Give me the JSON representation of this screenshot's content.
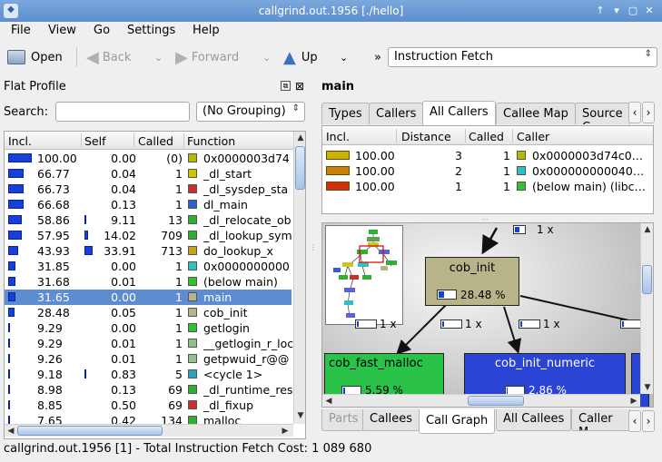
{
  "window": {
    "title": "callgrind.out.1956 [./hello]"
  },
  "menu": [
    "File",
    "View",
    "Go",
    "Settings",
    "Help"
  ],
  "toolbar": {
    "open": "Open",
    "back": "Back",
    "forward": "Forward",
    "up": "Up",
    "event_type": "Instruction Fetch",
    "more": "»"
  },
  "flat_profile": {
    "title": "Flat Profile",
    "search_label": "Search:",
    "search_value": "",
    "grouping": "(No Grouping)",
    "columns": [
      "Incl.",
      "Self",
      "Called",
      "Function"
    ],
    "rows": [
      {
        "incl": "100.00",
        "self": "0.00",
        "called": "(0)",
        "func": "0x0000003d74",
        "color": "#b8b800",
        "incl_frac": 1.0,
        "self_frac": 0
      },
      {
        "incl": "66.77",
        "self": "0.04",
        "called": "1",
        "func": "_dl_start",
        "color": "#c9c900",
        "incl_frac": 0.6677,
        "self_frac": 0
      },
      {
        "incl": "66.73",
        "self": "0.04",
        "called": "1",
        "func": "_dl_sysdep_sta",
        "color": "#c83030",
        "incl_frac": 0.6673,
        "self_frac": 0
      },
      {
        "incl": "66.68",
        "self": "0.13",
        "called": "1",
        "func": "dl_main",
        "color": "#3060c8",
        "incl_frac": 0.6668,
        "self_frac": 0
      },
      {
        "incl": "58.86",
        "self": "9.11",
        "called": "13",
        "func": "_dl_relocate_ob",
        "color": "#30b030",
        "incl_frac": 0.5886,
        "self_frac": 0.0911
      },
      {
        "incl": "57.95",
        "self": "14.02",
        "called": "709",
        "func": "_dl_lookup_sym",
        "color": "#30b030",
        "incl_frac": 0.5795,
        "self_frac": 0.1402
      },
      {
        "incl": "43.93",
        "self": "33.91",
        "called": "713",
        "func": "do_lookup_x",
        "color": "#c8a020",
        "incl_frac": 0.4393,
        "self_frac": 0.3391
      },
      {
        "incl": "31.85",
        "self": "0.00",
        "called": "1",
        "func": "0x0000000000",
        "color": "#30c0c0",
        "incl_frac": 0.3185,
        "self_frac": 0
      },
      {
        "incl": "31.68",
        "self": "0.01",
        "called": "1",
        "func": "(below main)",
        "color": "#30c030",
        "incl_frac": 0.3168,
        "self_frac": 0
      },
      {
        "incl": "31.65",
        "self": "0.00",
        "called": "1",
        "func": "main",
        "color": "#b8b48a",
        "incl_frac": 0.3165,
        "self_frac": 0,
        "selected": true
      },
      {
        "incl": "28.48",
        "self": "0.05",
        "called": "1",
        "func": "cob_init",
        "color": "#b8b48a",
        "incl_frac": 0.2848,
        "self_frac": 0
      },
      {
        "incl": "9.29",
        "self": "0.00",
        "called": "1",
        "func": "getlogin",
        "color": "#30c030",
        "incl_frac": 0.0929,
        "self_frac": 0
      },
      {
        "incl": "9.29",
        "self": "0.01",
        "called": "1",
        "func": "__getlogin_r_loc",
        "color": "#90c090",
        "incl_frac": 0.0929,
        "self_frac": 0
      },
      {
        "incl": "9.26",
        "self": "0.01",
        "called": "1",
        "func": "getpwuid_r@@",
        "color": "#90c090",
        "incl_frac": 0.0926,
        "self_frac": 0
      },
      {
        "incl": "9.18",
        "self": "0.83",
        "called": "5",
        "func": "<cycle 1>",
        "color": "#30a0c0",
        "incl_frac": 0.0918,
        "self_frac": 0.0083
      },
      {
        "incl": "8.98",
        "self": "0.13",
        "called": "69",
        "func": "_dl_runtime_res",
        "color": "#30b030",
        "incl_frac": 0.0898,
        "self_frac": 0
      },
      {
        "incl": "8.85",
        "self": "0.50",
        "called": "69",
        "func": "_dl_fixup",
        "color": "#c83030",
        "incl_frac": 0.0885,
        "self_frac": 0
      },
      {
        "incl": "7.65",
        "self": "0.42",
        "called": "134",
        "func": "malloc",
        "color": "#30b030",
        "incl_frac": 0.0765,
        "self_frac": 0
      }
    ]
  },
  "detail": {
    "title": "main",
    "top_tabs": [
      {
        "label": "Types"
      },
      {
        "label": "Callers"
      },
      {
        "label": "All Callers",
        "active": true
      },
      {
        "label": "Callee Map"
      },
      {
        "label": "Source C"
      }
    ],
    "caller_columns": [
      "Incl.",
      "Distance",
      "Called",
      "Caller"
    ],
    "callers": [
      {
        "incl": "100.00",
        "distance": "3",
        "called": "1",
        "caller": "0x0000003d74c0…",
        "color": "#b8b800",
        "bar": "#c8b400"
      },
      {
        "incl": "100.00",
        "distance": "2",
        "called": "1",
        "caller": "0x000000000040…",
        "color": "#30c0c0",
        "bar": "#c8820a"
      },
      {
        "incl": "100.00",
        "distance": "1",
        "called": "1",
        "caller": "(below main) (libc…",
        "color": "#30c030",
        "bar": "#d03010"
      }
    ],
    "graph": {
      "top_call": "1 x",
      "node_main": "cob_init",
      "node_main_pct": "28.48 %",
      "calls_left": "1 x",
      "calls_mid": "1 x",
      "calls_right": "1 x",
      "node_a": "cob_fast_malloc",
      "node_a_pct": "5.59 %",
      "node_b": "cob_init_numeric",
      "node_b_pct": "2.86 %"
    },
    "bottom_tabs": [
      {
        "label": "Parts",
        "disabled": true
      },
      {
        "label": "Callees"
      },
      {
        "label": "Call Graph",
        "active": true
      },
      {
        "label": "All Callees"
      },
      {
        "label": "Caller M"
      }
    ]
  },
  "status": "callgrind.out.1956 [1] - Total Instruction Fetch Cost: 1 089 680",
  "colors": {
    "selection": "#5e8cd0",
    "bar": "#1740d8",
    "titlebar": "#6a9ad4"
  }
}
